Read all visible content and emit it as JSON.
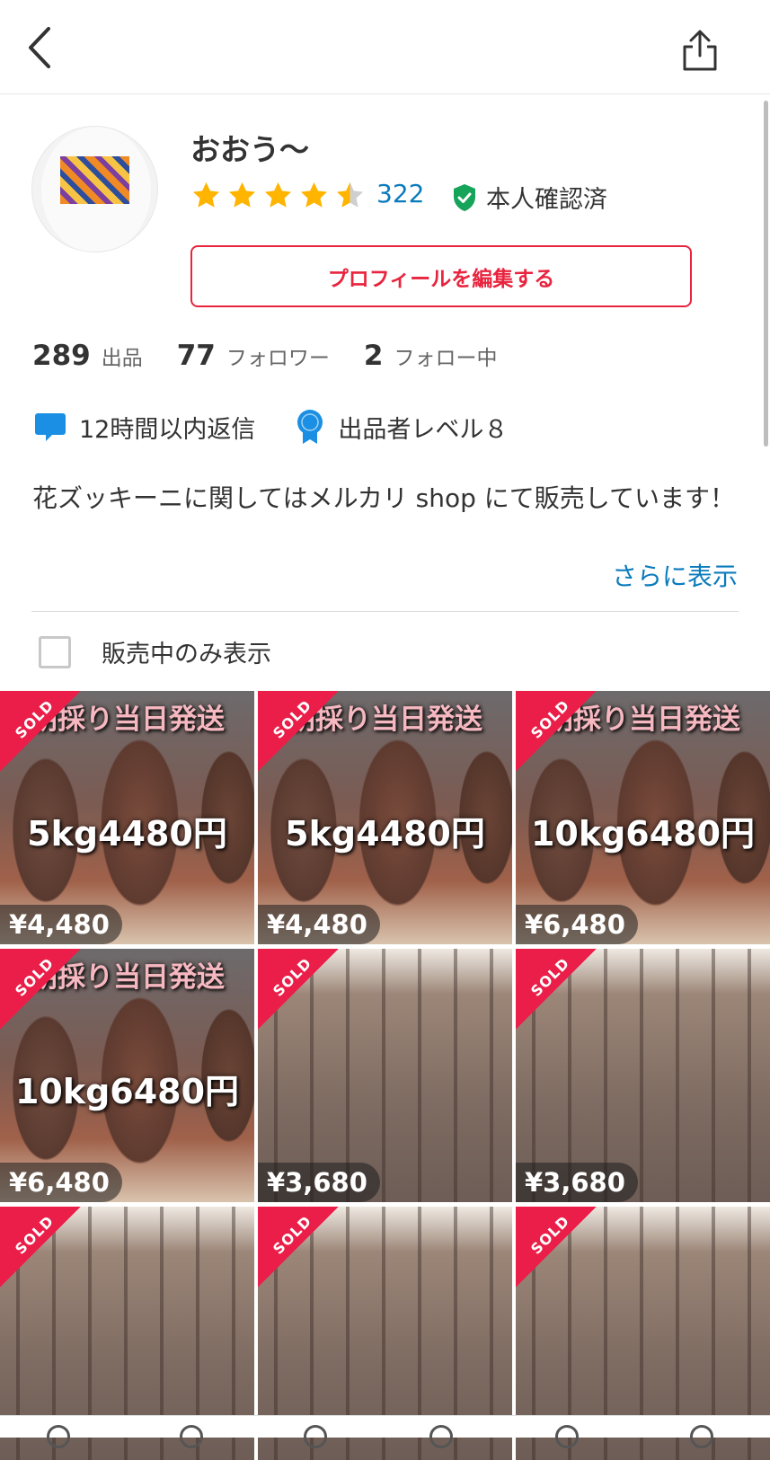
{
  "header": {
    "back_icon": "chevron-left-icon",
    "share_icon": "share-icon"
  },
  "profile": {
    "username": "おおう〜",
    "rating": 4.5,
    "rating_count": "322",
    "verified_label": "本人確認済",
    "edit_button": "プロフィールを編集する"
  },
  "stats": [
    {
      "num": "289",
      "label": "出品"
    },
    {
      "num": "77",
      "label": "フォロワー"
    },
    {
      "num": "2",
      "label": "フォロー中"
    }
  ],
  "badges": [
    {
      "icon": "chat-bubble-icon",
      "label": "12時間以内返信"
    },
    {
      "icon": "award-ribbon-icon",
      "label": "出品者レベル８"
    }
  ],
  "bio": "花ズッキーニに関してはメルカリ shop にて販売しています！",
  "more_link": "さらに表示",
  "filter_label": "販売中のみ表示",
  "sold_label": "SOLD",
  "items": [
    {
      "price": "¥4,480",
      "caption_top": "朝採り当日発送",
      "caption_mid": "5kg4480円",
      "photo": "bamboo-close"
    },
    {
      "price": "¥4,480",
      "caption_top": "朝採り当日発送",
      "caption_mid": "5kg4480円",
      "photo": "bamboo-close"
    },
    {
      "price": "¥6,480",
      "caption_top": "朝採り当日発送",
      "caption_mid": "10kg6480円",
      "photo": "bamboo-close"
    },
    {
      "price": "¥6,480",
      "caption_top": "朝採り当日発送",
      "caption_mid": "10kg6480円",
      "photo": "bamboo-close"
    },
    {
      "price": "¥3,680",
      "caption_top": "",
      "caption_mid": "",
      "photo": "bamboo-bunch"
    },
    {
      "price": "¥3,680",
      "caption_top": "",
      "caption_mid": "",
      "photo": "bamboo-bunch"
    },
    {
      "price": "",
      "caption_top": "",
      "caption_mid": "",
      "photo": "bamboo-bunch"
    },
    {
      "price": "",
      "caption_top": "",
      "caption_mid": "",
      "photo": "bamboo-bunch"
    },
    {
      "price": "",
      "caption_top": "",
      "caption_mid": "",
      "photo": "bamboo-bunch"
    }
  ],
  "colors": {
    "accent_red": "#e8243f",
    "link_blue": "#0b7bbd",
    "sold_red": "#ea1e48"
  }
}
